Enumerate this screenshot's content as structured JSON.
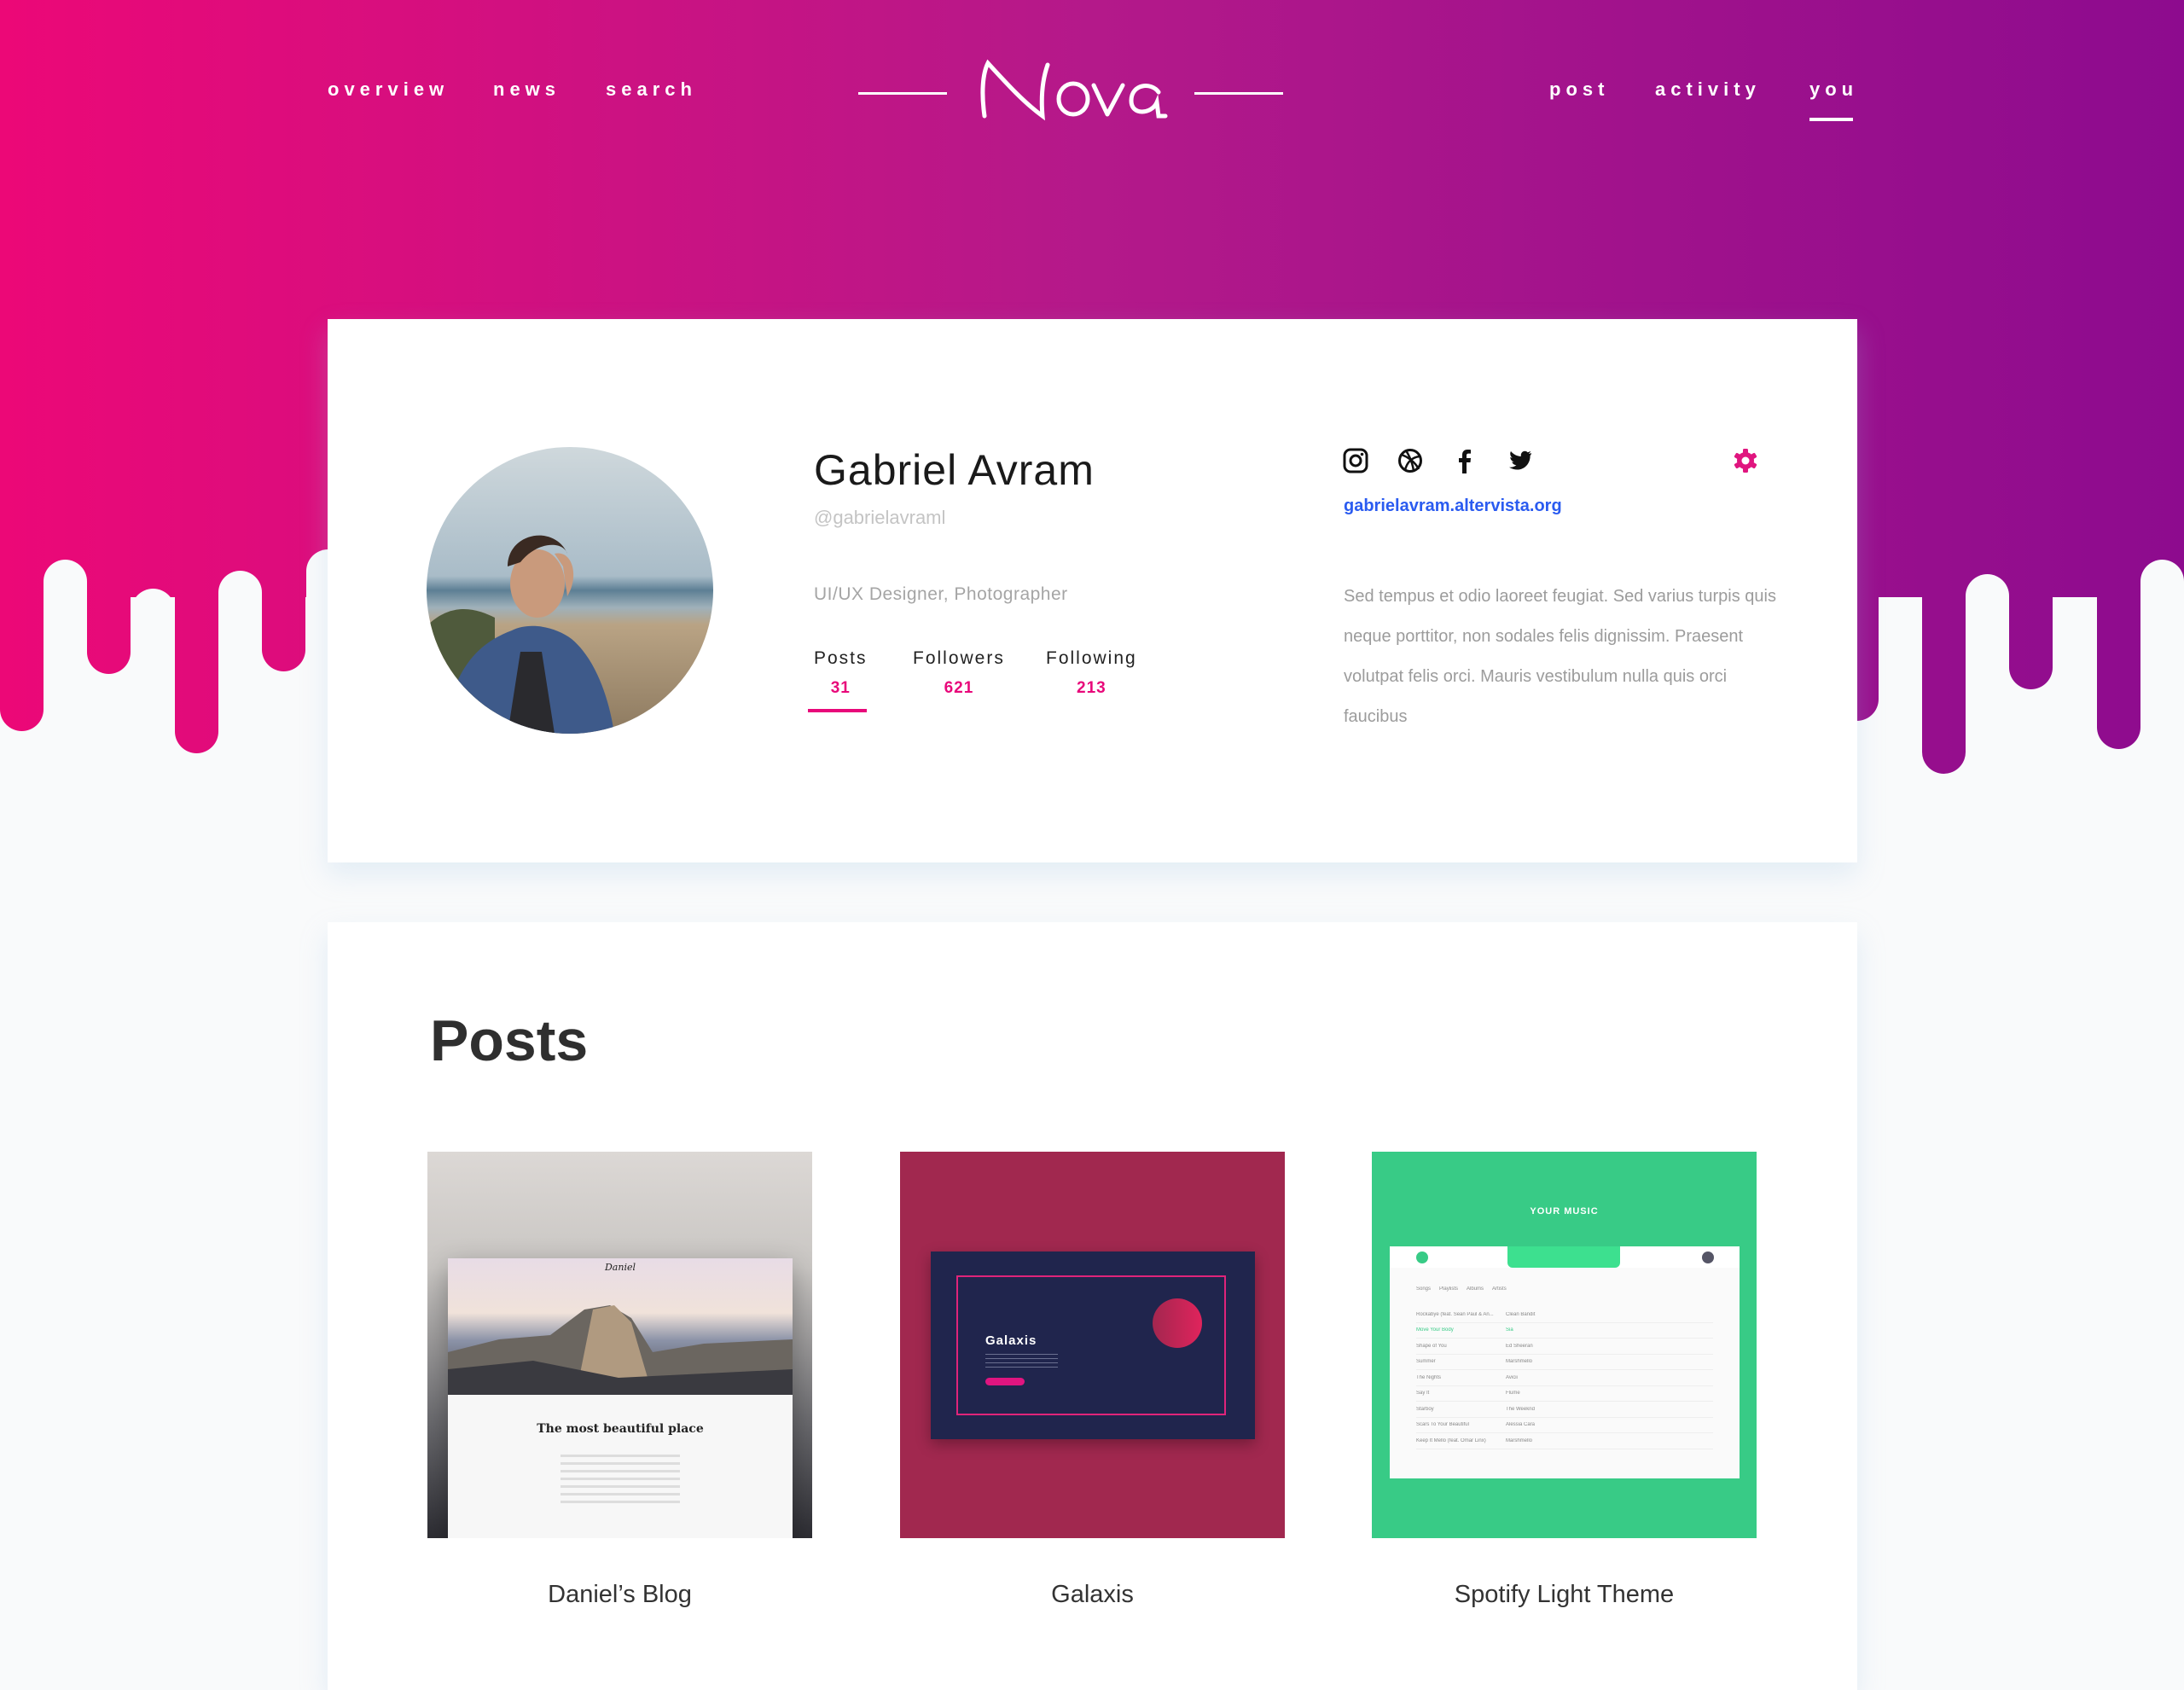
{
  "colors": {
    "gradient_start": "#ec0877",
    "gradient_end": "#8d0b8e",
    "accent": "#e8087a",
    "link": "#2a5bf0",
    "page_bg": "#f9fafb"
  },
  "nav": {
    "left": [
      {
        "label": "overview"
      },
      {
        "label": "news"
      },
      {
        "label": "search"
      }
    ],
    "logo": "Nova",
    "right": [
      {
        "label": "post"
      },
      {
        "label": "activity"
      },
      {
        "label": "you",
        "active": true
      }
    ]
  },
  "profile": {
    "name": "Gabriel Avram",
    "handle": "@gabrielavraml",
    "role": "UI/UX Designer, Photographer",
    "stats": [
      {
        "label": "Posts",
        "value": "31",
        "active": true
      },
      {
        "label": "Followers",
        "value": "621"
      },
      {
        "label": "Following",
        "value": "213"
      }
    ],
    "social_icons": [
      "instagram-icon",
      "dribbble-icon",
      "facebook-icon",
      "twitter-icon"
    ],
    "settings_icon": "gear-icon",
    "website": "gabrielavram.altervista.org",
    "bio": "Sed tempus et odio laoreet feugiat. Sed varius turpis quis neque porttitor, non sodales felis dignissim. Praesent volutpat felis orci. Mauris vestibulum nulla quis orci faucibus"
  },
  "posts": {
    "title": "Posts",
    "items": [
      {
        "caption": "Daniel’s Blog",
        "thumb": {
          "logo": "Daniel",
          "headline": "The most beautiful place"
        }
      },
      {
        "caption": "Galaxis",
        "thumb": {
          "title": "Galaxis"
        }
      },
      {
        "caption": "Spotify Light Theme",
        "thumb": {
          "title": "YOUR MUSIC",
          "tabs": [
            "Songs",
            "Playlists",
            "Albums",
            "Artists"
          ],
          "rows": [
            {
              "song": "Rockabye (feat. Sean Paul & An...",
              "artist": "Clean Bandit"
            },
            {
              "song": "Move Your Body",
              "artist": "Sia"
            },
            {
              "song": "Shape of You",
              "artist": "Ed Sheeran"
            },
            {
              "song": "Summer",
              "artist": "Marshmello"
            },
            {
              "song": "The Nights",
              "artist": "Avicii"
            },
            {
              "song": "Say It",
              "artist": "Flume"
            },
            {
              "song": "Starboy",
              "artist": "The Weeknd"
            },
            {
              "song": "Scars To Your Beautiful",
              "artist": "Alessia Cara"
            },
            {
              "song": "Keep It Mello (feat. Omar Linx)",
              "artist": "Marshmello"
            }
          ]
        }
      }
    ]
  }
}
